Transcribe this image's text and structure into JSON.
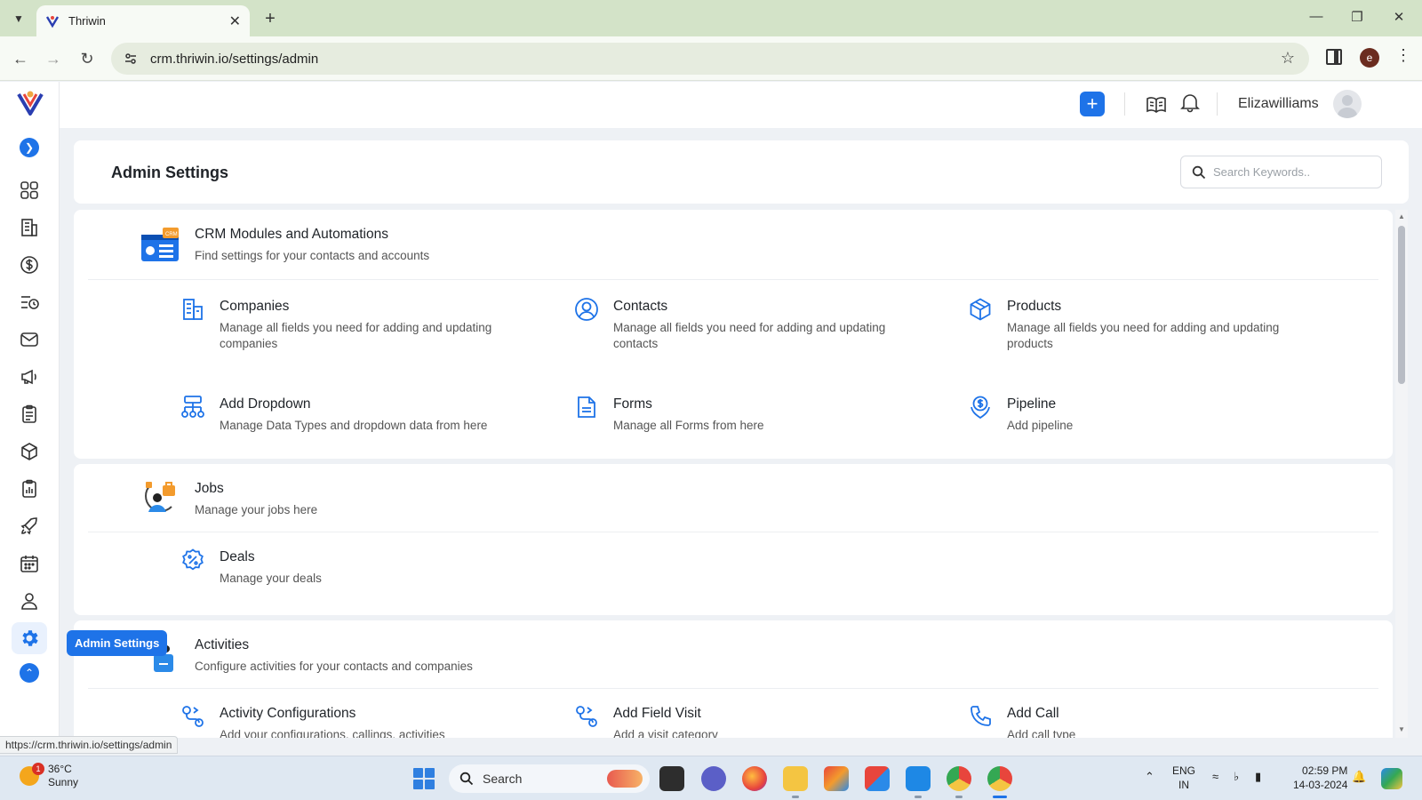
{
  "browser": {
    "tab_title": "Thriwin",
    "url": "crm.thriwin.io/settings/admin",
    "profile_letter": "e",
    "status_url": "https://crm.thriwin.io/settings/admin"
  },
  "topbar": {
    "username": "Elizawilliams"
  },
  "sidebar": {
    "items": [
      "dashboard-icon",
      "building-icon",
      "dollar-icon",
      "task-list-icon",
      "mail-icon",
      "megaphone-icon",
      "clipboard-icon",
      "box-icon",
      "report-icon",
      "rocket-icon",
      "calendar-icon",
      "user-icon",
      "settings-icon"
    ],
    "active": "settings-icon",
    "tooltip": "Admin Settings"
  },
  "header": {
    "title": "Admin Settings",
    "search_placeholder": "Search Keywords.."
  },
  "sections": {
    "crm": {
      "title": "CRM Modules and Automations",
      "desc": "Find settings for your contacts and accounts",
      "items": [
        {
          "title": "Companies",
          "desc": "Manage all fields you need for adding and updating companies",
          "icon": "building-icon"
        },
        {
          "title": "Contacts",
          "desc": "Manage all fields you need for adding and updating contacts",
          "icon": "user-circle-icon"
        },
        {
          "title": "Products",
          "desc": "Manage all fields you need for adding and updating products",
          "icon": "box-icon"
        },
        {
          "title": "Add Dropdown",
          "desc": "Manage Data Types and dropdown data from here",
          "icon": "hierarchy-icon"
        },
        {
          "title": "Forms",
          "desc": "Manage all Forms from here",
          "icon": "document-icon"
        },
        {
          "title": "Pipeline",
          "desc": "Add pipeline",
          "icon": "pipeline-icon"
        }
      ]
    },
    "jobs": {
      "title": "Jobs",
      "desc": "Manage your jobs here",
      "items": [
        {
          "title": "Deals",
          "desc": "Manage your deals",
          "icon": "discount-icon"
        }
      ]
    },
    "activities": {
      "title": "Activities",
      "desc": "Configure activities for your contacts and companies",
      "items": [
        {
          "title": "Activity Configurations",
          "desc": "Add your configurations, callings, activities",
          "icon": "route-icon"
        },
        {
          "title": "Add Field Visit",
          "desc": "Add a visit category",
          "icon": "route-icon"
        },
        {
          "title": "Add Call",
          "desc": "Add call type",
          "icon": "phone-icon"
        }
      ]
    }
  },
  "taskbar": {
    "temperature": "36°C",
    "weather": "Sunny",
    "weather_badge": "1",
    "search_label": "Search",
    "lang_line1": "ENG",
    "lang_line2": "IN",
    "time": "02:59 PM",
    "date": "14-03-2024"
  },
  "colors": {
    "accent": "#1e73e8",
    "background": "#eef1f5"
  }
}
